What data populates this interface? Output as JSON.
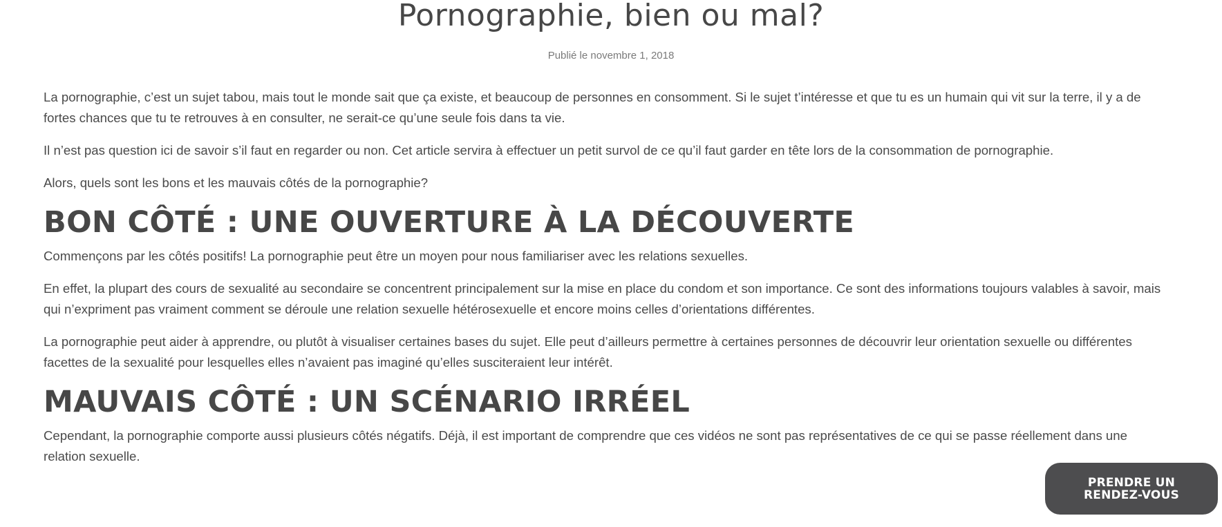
{
  "article": {
    "title": "Pornographie, bien ou mal?",
    "meta": "Publié le novembre 1, 2018",
    "intro": [
      "La pornographie, c’est un sujet tabou, mais tout le monde sait que ça existe, et beaucoup de personnes en consomment. Si le sujet t’intéresse et que tu es un humain qui vit sur la terre, il y a de fortes chances que tu te retrouves à en consulter, ne serait-ce qu’une seule fois dans ta vie.",
      "Il n’est pas question ici de savoir s’il faut en regarder ou non. Cet article servira à effectuer un petit survol de ce qu’il faut garder en tête lors de la consommation de pornographie.",
      "Alors, quels sont les bons et les mauvais côtés de la pornographie?"
    ],
    "section1": {
      "heading": "BON CÔTÉ : UNE OUVERTURE À LA DÉCOUVERTE",
      "paragraphs": [
        "Commençons par les côtés positifs! La pornographie peut être un moyen pour nous familiariser avec les relations sexuelles.",
        "En effet, la plupart des cours de sexualité au secondaire se concentrent principalement sur la mise en place du condom et son importance. Ce sont des informations toujours valables à savoir, mais qui n’expriment pas vraiment comment se déroule une relation sexuelle hétérosexuelle et encore moins celles d’orientations différentes.",
        "La pornographie peut aider à apprendre, ou plutôt à visualiser certaines bases du sujet. Elle peut d’ailleurs permettre à certaines personnes de découvrir leur orientation sexuelle ou différentes facettes de la sexualité pour lesquelles elles n’avaient pas imaginé qu’elles susciteraient leur intérêt."
      ]
    },
    "section2": {
      "heading": "MAUVAIS CÔTÉ : UN SCÉNARIO IRRÉEL",
      "paragraphs": [
        "Cependant, la pornographie comporte aussi plusieurs côtés négatifs. Déjà, il est important de comprendre que ces vidéos ne sont pas représentatives de ce qui se passe réellement dans une relation sexuelle."
      ]
    }
  },
  "cta": {
    "label": "PRENDRE UN RENDEZ-VOUS"
  }
}
